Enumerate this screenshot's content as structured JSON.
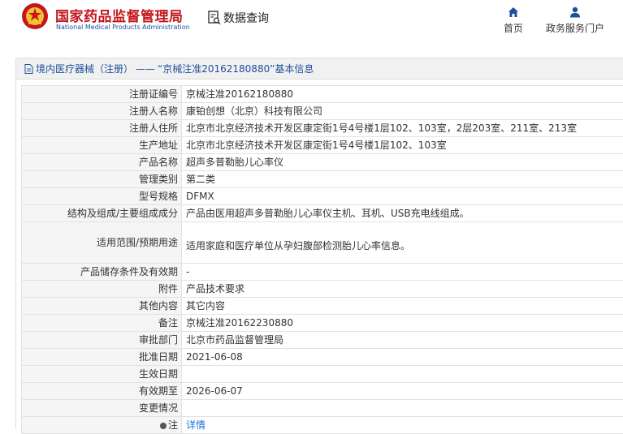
{
  "header": {
    "brand_cn": "国家药品监督管理局",
    "brand_en": "National Medical Products Administration",
    "data_query": "数据查询",
    "nav": {
      "home": "首页",
      "service": "政务服务门户"
    },
    "accent_red": "#c4161c",
    "accent_blue": "#1e4f9c"
  },
  "breadcrumb": {
    "section": "境内医疗器械（注册）",
    "separator": "——",
    "current": "“京械注准20162180880”基本信息"
  },
  "rows": [
    {
      "label": "注册证编号",
      "value": "京械注准20162180880"
    },
    {
      "label": "注册人名称",
      "value": "康铂创想（北京）科技有限公司"
    },
    {
      "label": "注册人住所",
      "value": "北京市北京经济技术开发区康定街1号4号楼1层102、103室，2层203室、211室、213室"
    },
    {
      "label": "生产地址",
      "value": "北京市北京经济技术开发区康定街1号4号楼1层102、103室"
    },
    {
      "label": "产品名称",
      "value": "超声多普勒胎儿心率仪"
    },
    {
      "label": "管理类别",
      "value": "第二类"
    },
    {
      "label": "型号规格",
      "value": "DFMX"
    },
    {
      "label": "结构及组成/主要组成成分",
      "value": "产品由医用超声多普勒胎儿心率仪主机、耳机、USB充电线组成。"
    },
    {
      "label": "适用范围/预期用途",
      "value": "适用家庭和医疗单位从孕妇腹部检测胎儿心率信息。"
    },
    {
      "label": "产品储存条件及有效期",
      "value": "-"
    },
    {
      "label": "附件",
      "value": "产品技术要求"
    },
    {
      "label": "其他内容",
      "value": "其它内容"
    },
    {
      "label": "备注",
      "value": "京械注准20162230880"
    },
    {
      "label": "审批部门",
      "value": "北京市药品监督管理局"
    },
    {
      "label": "批准日期",
      "value": "2021-06-08"
    },
    {
      "label": "生效日期",
      "value": ""
    },
    {
      "label": "有效期至",
      "value": "2026-06-07"
    },
    {
      "label": "变更情况",
      "value": ""
    },
    {
      "label": "注",
      "value": "详情"
    }
  ]
}
